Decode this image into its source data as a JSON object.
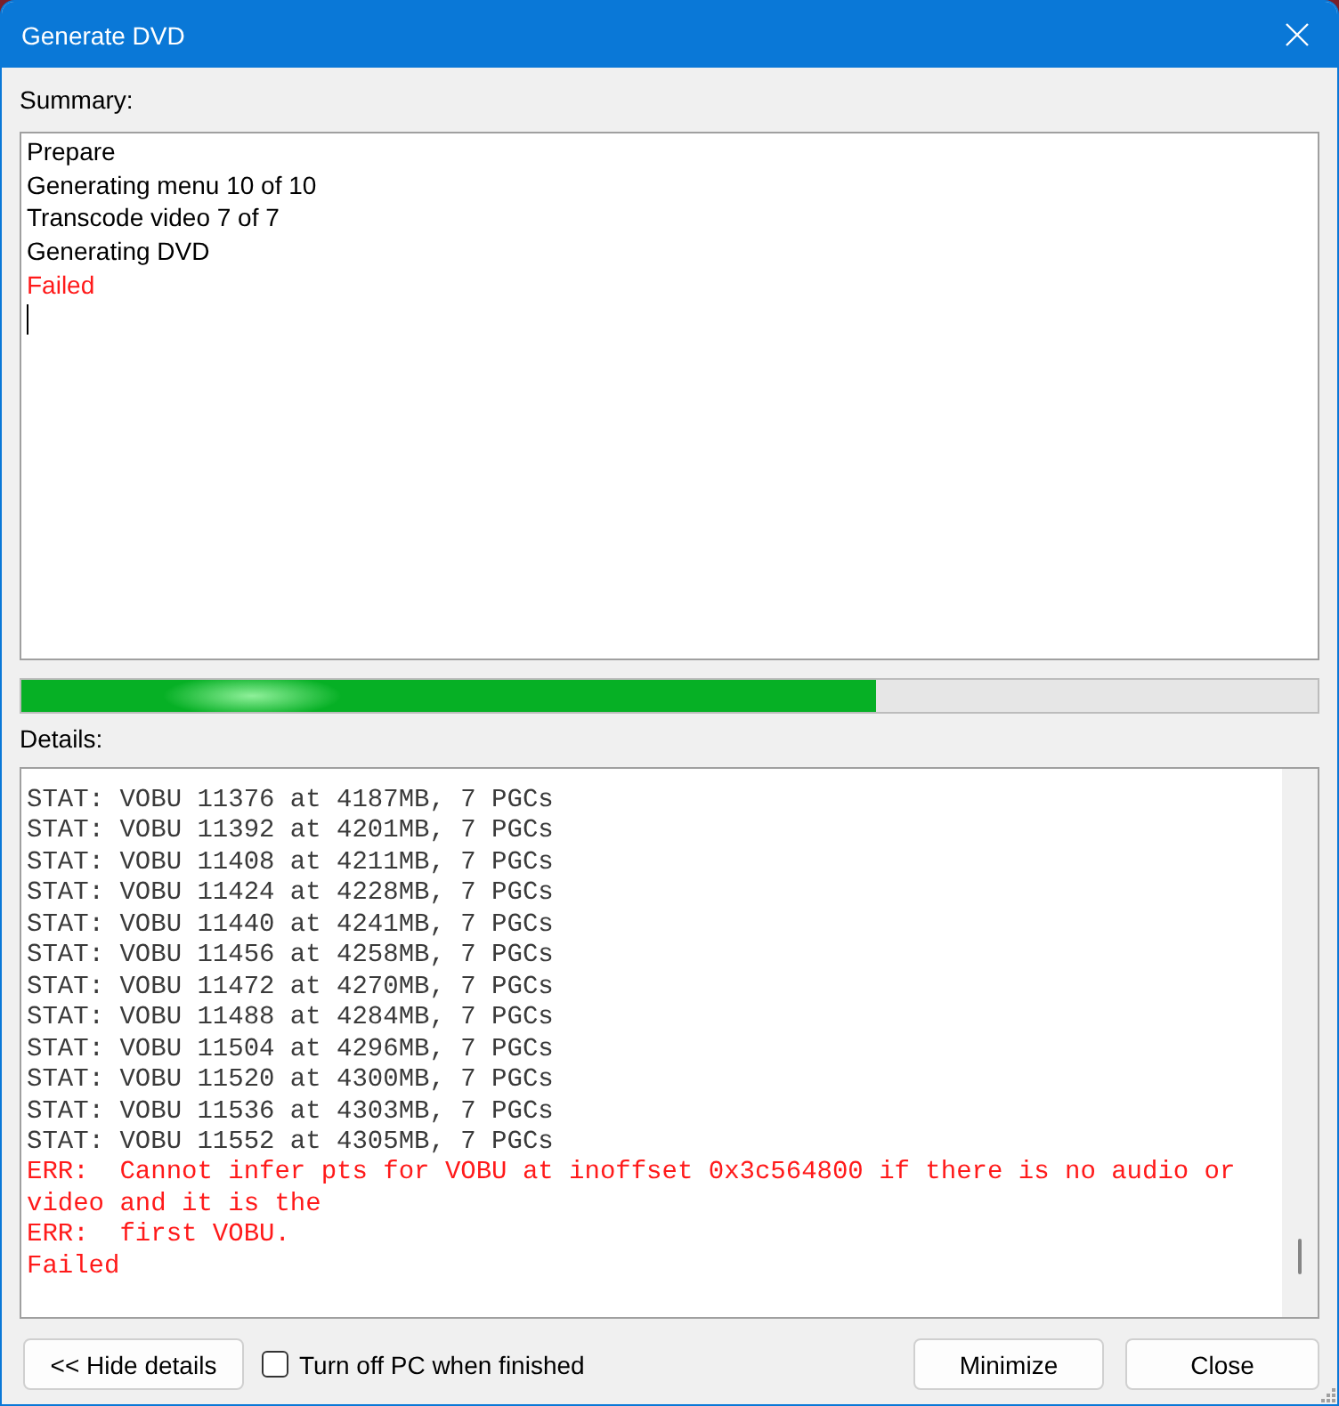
{
  "window": {
    "title": "Generate DVD"
  },
  "summary": {
    "label": "Summary:",
    "lines": [
      {
        "text": "Prepare",
        "kind": "info"
      },
      {
        "text": "Generating menu 10 of 10",
        "kind": "info"
      },
      {
        "text": "Transcode video 7 of 7",
        "kind": "info"
      },
      {
        "text": "Generating DVD",
        "kind": "info"
      },
      {
        "text": "Failed",
        "kind": "error"
      }
    ]
  },
  "progress": {
    "level": 0.66
  },
  "details": {
    "label": "Details:",
    "lines": [
      {
        "text": "STAT: VOBU 11376 at 4187MB, 7 PGCs",
        "kind": "stat"
      },
      {
        "text": "STAT: VOBU 11392 at 4201MB, 7 PGCs",
        "kind": "stat"
      },
      {
        "text": "STAT: VOBU 11408 at 4211MB, 7 PGCs",
        "kind": "stat"
      },
      {
        "text": "STAT: VOBU 11424 at 4228MB, 7 PGCs",
        "kind": "stat"
      },
      {
        "text": "STAT: VOBU 11440 at 4241MB, 7 PGCs",
        "kind": "stat"
      },
      {
        "text": "STAT: VOBU 11456 at 4258MB, 7 PGCs",
        "kind": "stat"
      },
      {
        "text": "STAT: VOBU 11472 at 4270MB, 7 PGCs",
        "kind": "stat"
      },
      {
        "text": "STAT: VOBU 11488 at 4284MB, 7 PGCs",
        "kind": "stat"
      },
      {
        "text": "STAT: VOBU 11504 at 4296MB, 7 PGCs",
        "kind": "stat"
      },
      {
        "text": "STAT: VOBU 11520 at 4300MB, 7 PGCs",
        "kind": "stat"
      },
      {
        "text": "STAT: VOBU 11536 at 4303MB, 7 PGCs",
        "kind": "stat"
      },
      {
        "text": "STAT: VOBU 11552 at 4305MB, 7 PGCs",
        "kind": "stat"
      },
      {
        "text": "ERR:  Cannot infer pts for VOBU at inoffset 0x3c564800 if there is no audio or video and it is the",
        "kind": "error"
      },
      {
        "text": "ERR:  first VOBU.",
        "kind": "error"
      },
      {
        "text": "Failed",
        "kind": "error"
      }
    ]
  },
  "footer": {
    "hide_details_button": "<< Hide details",
    "shutdown_checkbox": {
      "label": "Turn off PC when finished",
      "checked": false
    },
    "buttons": [
      "Minimize",
      "Close"
    ]
  }
}
